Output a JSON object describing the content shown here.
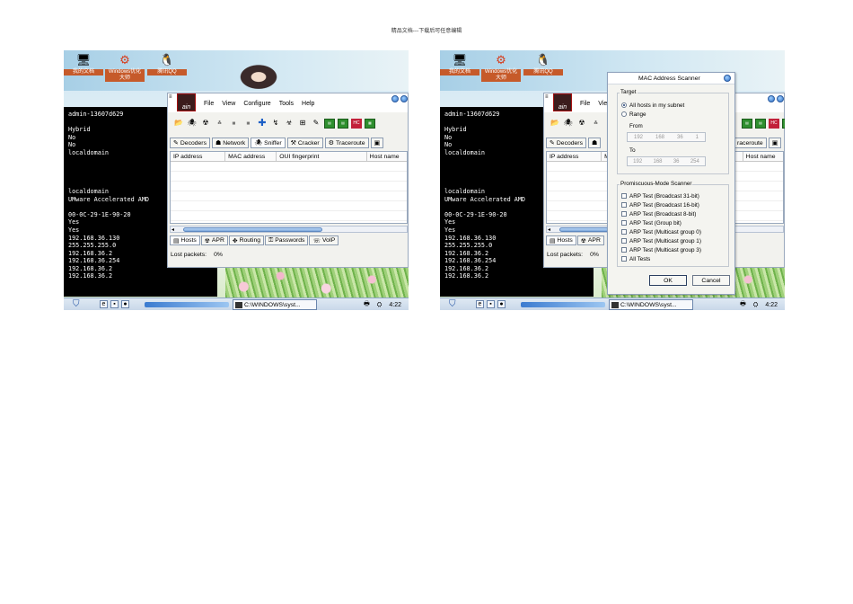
{
  "page_header": "精品文档---下载后可任意编辑",
  "desktop": {
    "icons": [
      {
        "label": "我的文档",
        "icon": "computer-icon"
      },
      {
        "label": "Windows优化大师",
        "icon": "optimizer-icon"
      },
      {
        "label": "腾讯QQ",
        "icon": "qq-penguin-icon"
      }
    ]
  },
  "console": {
    "lines": [
      "admin-13607d629",
      "",
      "Hybrid",
      "No",
      "No",
      "localdomain",
      "",
      "",
      "",
      "",
      "localdomain",
      "UMware Accelerated AMD",
      "",
      "00-0C-29-1E-90-20",
      "Yes",
      "Yes",
      "192.168.36.130",
      "255.255.255.0",
      "192.168.36.2",
      "192.168.36.254",
      "192.168.36.2",
      "192.168.36.2"
    ]
  },
  "cain": {
    "logo_text": "ain",
    "menu": [
      "File",
      "View",
      "Configure",
      "Tools",
      "Help"
    ],
    "tabs": [
      {
        "label": "Decoders",
        "icon": "decoder-icon"
      },
      {
        "label": "Network",
        "icon": "network-icon"
      },
      {
        "label": "Sniffer",
        "icon": "sniffer-icon"
      },
      {
        "label": "Cracker",
        "icon": "cracker-icon"
      },
      {
        "label": "Traceroute",
        "icon": "traceroute-icon"
      }
    ],
    "right_tabs": [
      {
        "label": "Decoders",
        "icon": "decoder-icon"
      },
      {
        "label": "raceroute",
        "icon": "traceroute-icon"
      }
    ],
    "columns": [
      "IP address",
      "MAC address",
      "OUI fingerprint",
      "Host name"
    ],
    "right_columns": [
      "IP address",
      "M",
      "Host name"
    ],
    "bottom_tabs": [
      {
        "label": "Hosts",
        "icon": "hosts-icon"
      },
      {
        "label": "APR",
        "icon": "apr-icon"
      },
      {
        "label": "Routing",
        "icon": "routing-icon"
      },
      {
        "label": "Passwords",
        "icon": "passwords-icon"
      },
      {
        "label": "VoIP",
        "icon": "voip-icon"
      }
    ],
    "right_bottom_tabs": [
      {
        "label": "Hosts",
        "icon": "hosts-icon"
      },
      {
        "label": "APR",
        "icon": "apr-icon"
      }
    ],
    "status_label": "Lost packets:",
    "status_value": "0%",
    "right_menu": [
      "File",
      "View"
    ]
  },
  "taskbar": {
    "task_label": "C:\\WINDOWS\\syst...",
    "clock": "4:22"
  },
  "mac_dialog": {
    "title": "MAC Address Scanner",
    "target_label": "Target",
    "all_hosts_label": "All hosts in my subnet",
    "range_label": "Range",
    "selected_target": "All hosts in my subnet",
    "from_label": "From",
    "from_ip": [
      "192",
      "168",
      "36",
      "1"
    ],
    "to_label": "To",
    "to_ip": [
      "192",
      "168",
      "36",
      "254"
    ],
    "promisc_label": "Promiscuous-Mode Scanner",
    "tests": [
      "ARP Test (Broadcast 31-bit)",
      "ARP Test (Broadcast 16-bit)",
      "ARP Test (Broadcast 8-bit)",
      "ARP Test (Group bit)",
      "ARP Test (Multicast group 0)",
      "ARP Test (Multicast group 1)",
      "ARP Test (Multicast group 3)",
      "All Tests"
    ],
    "ok_label": "OK",
    "cancel_label": "Cancel"
  }
}
